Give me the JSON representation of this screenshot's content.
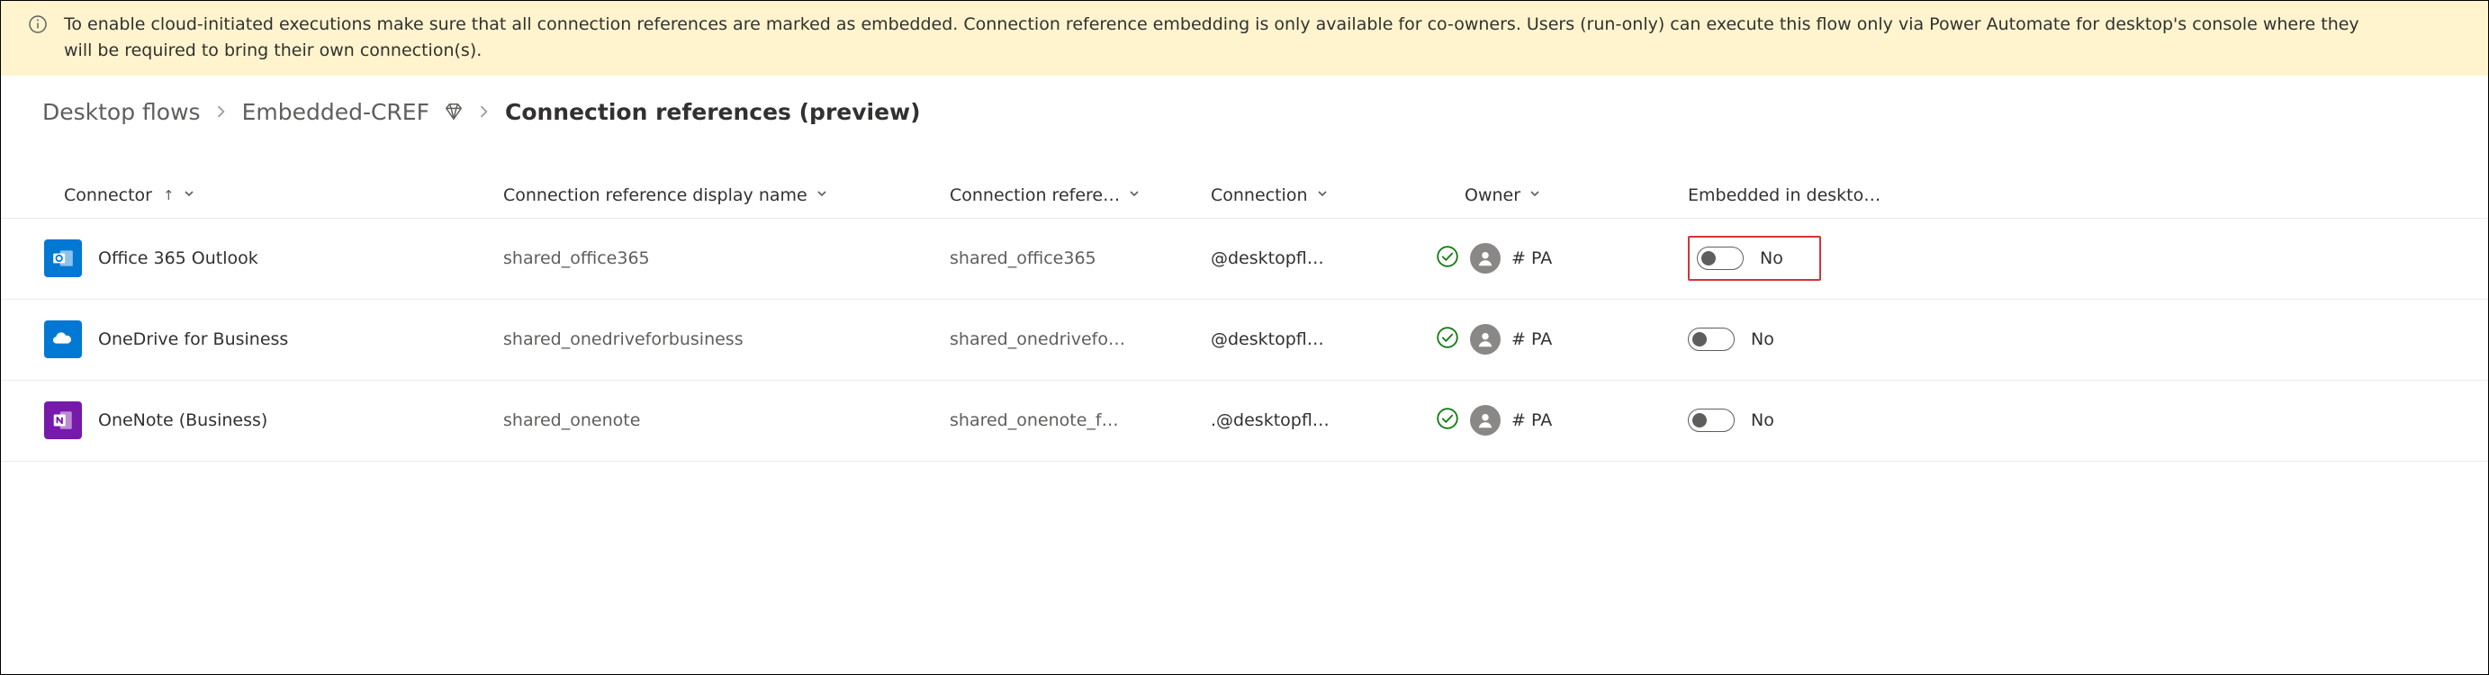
{
  "banner": {
    "message": "To enable cloud-initiated executions make sure that all connection references are marked as embedded. Connection reference embedding is only available for co-owners. Users (run-only) can execute this flow only via Power Automate for desktop's console where they will be required to bring their own connection(s)."
  },
  "breadcrumb": {
    "root": "Desktop flows",
    "flow": "Embedded-CREF",
    "current": "Connection references (preview)"
  },
  "columns": {
    "connector": "Connector",
    "display_name": "Connection reference display name",
    "reference_name": "Connection refere…",
    "connection": "Connection",
    "owner": "Owner",
    "embedded": "Embedded in deskto…"
  },
  "rows": [
    {
      "icon": "outlook",
      "connector": "Office 365 Outlook",
      "display_name": "shared_office365",
      "reference_name": "shared_office365",
      "connection": "@desktopfl…",
      "owner": "# PA",
      "embedded_label": "No",
      "highlighted": true
    },
    {
      "icon": "onedrive",
      "connector": "OneDrive for Business",
      "display_name": "shared_onedriveforbusiness",
      "reference_name": "shared_onedrivefo…",
      "connection": "@desktopfl…",
      "owner": "# PA",
      "embedded_label": "No",
      "highlighted": false
    },
    {
      "icon": "onenote",
      "connector": "OneNote (Business)",
      "display_name": "shared_onenote",
      "reference_name": "shared_onenote_f…",
      "connection": ".@desktopfl…",
      "owner": "# PA",
      "embedded_label": "No",
      "highlighted": false
    }
  ]
}
